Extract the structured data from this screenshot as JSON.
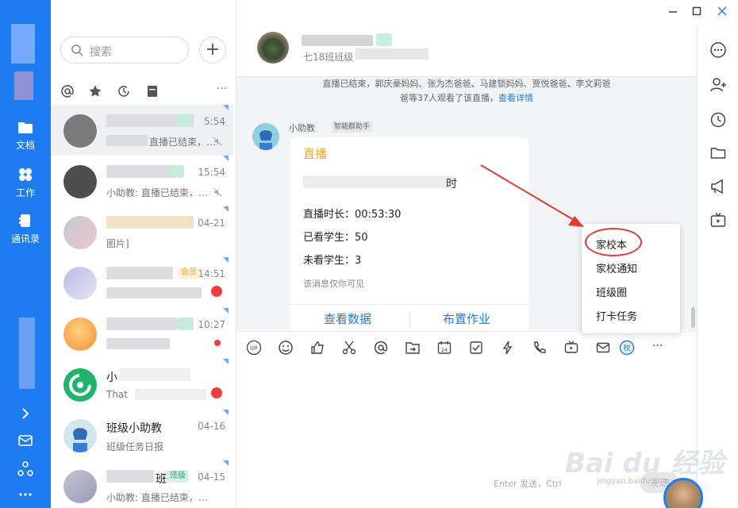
{
  "colors": {
    "accent": "#1d7cf2",
    "card_title": "#f5a623",
    "alert": "#f23c3c",
    "annotation": "#e53935"
  },
  "rail": {
    "items": [
      {
        "label": "文档",
        "icon": "folder-icon"
      },
      {
        "label": "工作",
        "icon": "grid-icon"
      },
      {
        "label": "通讯录",
        "icon": "contacts-icon"
      }
    ]
  },
  "search": {
    "placeholder": "搜索"
  },
  "conversations": [
    {
      "name": "",
      "time": "5:54",
      "msg": "直播已结束，…"
    },
    {
      "name": "",
      "time": "15:54",
      "msg": "小助教: 直播已结束，…"
    },
    {
      "name": "",
      "time": "04-21",
      "msg": "图片]"
    },
    {
      "name": "",
      "time": "14:51",
      "msg": "",
      "tag": "会员"
    },
    {
      "name": "",
      "time": "10:27",
      "msg": ""
    },
    {
      "name": "小",
      "time": "",
      "msg": "That"
    },
    {
      "name": "班级小助教",
      "time": "04-16",
      "msg": "班级任务日报"
    },
    {
      "name": "班",
      "time": "04-15",
      "msg": "小助教: 直播已结束，…",
      "tag": "班级"
    }
  ],
  "chat": {
    "group_subtitle": "七18班班级",
    "system_line1": "直播已结束，郭庆豪妈妈、张为杰爸爸、马建锁妈妈、贾悦爸爸、李文莉爸",
    "system_line2": "爸等37人观看了该直播，",
    "system_link": "查看详情",
    "sender": "小助教",
    "sender_tag": "智能群助手",
    "card": {
      "title": "直播",
      "title_end": "时",
      "duration": "直播时长：00:53:30",
      "watched": "已看学生：50",
      "unwatched": "未看学生：3",
      "note": "该消息仅你可见",
      "action_left": "查看数据",
      "action_right": "布置作业"
    },
    "input_hint": "Enter 发送，Ctrl",
    "send_label": "发送"
  },
  "menu": {
    "items": [
      "家校本",
      "家校通知",
      "班级圈",
      "打卡任务"
    ]
  },
  "watermark": "Bai du 经验",
  "watermark_sub": "jingyan.baidu.com"
}
